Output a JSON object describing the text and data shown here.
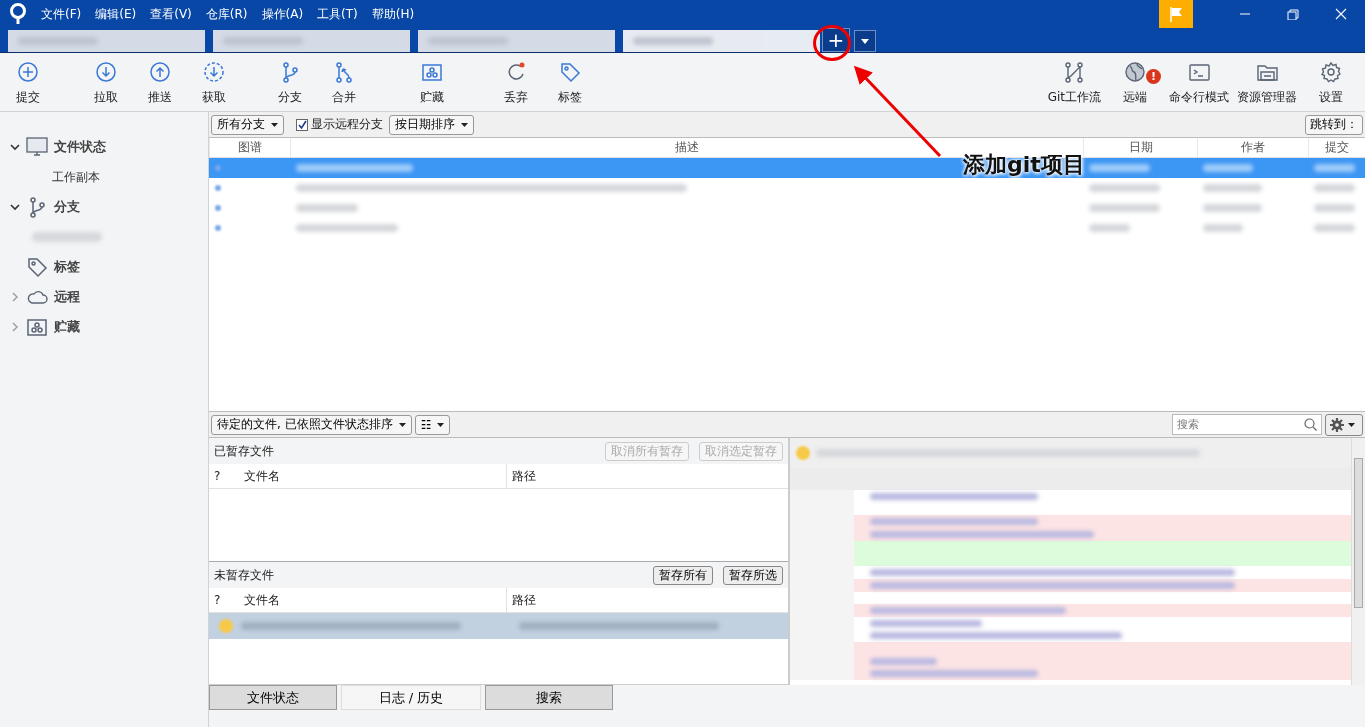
{
  "window": {
    "menu": [
      "文件(F)",
      "编辑(E)",
      "查看(V)",
      "仓库(R)",
      "操作(A)",
      "工具(T)",
      "帮助(H)"
    ]
  },
  "repo_tabs": [
    {
      "selected": false
    },
    {
      "selected": false
    },
    {
      "selected": false
    },
    {
      "selected": true
    }
  ],
  "new_tab_button": {
    "label": "+"
  },
  "toolbar_left": [
    {
      "label": "提交",
      "kind": "commit"
    },
    {
      "label": "拉取",
      "kind": "pull"
    },
    {
      "label": "推送",
      "kind": "push"
    },
    {
      "label": "获取",
      "kind": "fetch"
    },
    {
      "label": "分支",
      "kind": "branch"
    },
    {
      "label": "合并",
      "kind": "merge"
    },
    {
      "label": "贮藏",
      "kind": "stash"
    },
    {
      "label": "丢弃",
      "kind": "discard"
    },
    {
      "label": "标签",
      "kind": "tag"
    }
  ],
  "toolbar_right": [
    {
      "label": "Git工作流",
      "kind": "flow"
    },
    {
      "label": "远端",
      "kind": "globe",
      "badge": "!"
    },
    {
      "label": "命令行模式",
      "kind": "terminal"
    },
    {
      "label": "资源管理器",
      "kind": "folder"
    },
    {
      "label": "设置",
      "kind": "gear"
    }
  ],
  "sidebar": [
    {
      "label": "文件状态",
      "kind": "monitor",
      "expanded": true,
      "children": [
        {
          "label": "工作副本"
        }
      ]
    },
    {
      "label": "分支",
      "kind": "branch",
      "expanded": true,
      "children": [
        {
          "kind": "blurred"
        }
      ]
    },
    {
      "label": "标签",
      "kind": "tag"
    },
    {
      "label": "远程",
      "kind": "cloud",
      "expanded": false
    },
    {
      "label": "贮藏",
      "kind": "stash",
      "expanded": false
    }
  ],
  "filters": {
    "branch_select": "所有分支",
    "show_remote": {
      "label": "显示远程分支",
      "checked": true
    },
    "sort_select": "按日期排序",
    "jump_button": "跳转到："
  },
  "commit_table": {
    "columns": [
      "图谱",
      "描述",
      "日期",
      "作者",
      "提交"
    ],
    "rows": [
      {
        "selected": true
      },
      {
        "selected": false
      },
      {
        "selected": false
      },
      {
        "selected": false
      }
    ]
  },
  "files_toolbar": {
    "sort_select": "待定的文件, 已依照文件状态排序",
    "view_select": "☷",
    "search": {
      "placeholder": "搜索"
    }
  },
  "staged": {
    "title": "已暂存文件",
    "buttons": [
      {
        "label": "取消所有暂存",
        "disabled": true
      },
      {
        "label": "取消选定暂存",
        "disabled": true
      }
    ],
    "columns": [
      "?",
      "文件名",
      "路径"
    ]
  },
  "unstaged": {
    "title": "未暂存文件",
    "buttons": [
      {
        "label": "暂存所有",
        "disabled": false
      },
      {
        "label": "暂存所选",
        "disabled": false
      }
    ],
    "columns": [
      "?",
      "文件名",
      "路径"
    ],
    "rows": [
      {
        "selected": true
      }
    ]
  },
  "view_tabs": [
    {
      "label": "文件状态",
      "selected": false
    },
    {
      "label": "日志 / 历史",
      "selected": true
    },
    {
      "label": "搜索",
      "selected": false
    }
  ],
  "diff": {
    "lines": [
      {
        "kind": "context"
      },
      {
        "kind": "blank"
      },
      {
        "kind": "removed"
      },
      {
        "kind": "removed"
      },
      {
        "kind": "added"
      },
      {
        "kind": "added"
      },
      {
        "kind": "context"
      },
      {
        "kind": "removed"
      },
      {
        "kind": "blank"
      },
      {
        "kind": "removed"
      },
      {
        "kind": "context"
      },
      {
        "kind": "context"
      },
      {
        "kind": "removed"
      },
      {
        "kind": "removed"
      },
      {
        "kind": "removed"
      }
    ]
  },
  "annotation": {
    "text": "添加git项目"
  }
}
